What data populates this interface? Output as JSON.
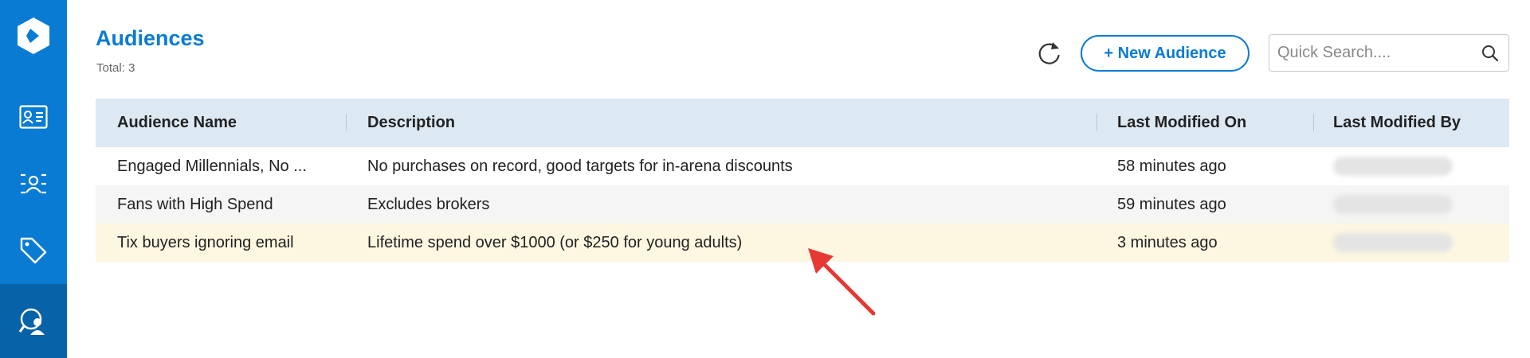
{
  "sidebar": {
    "logo": "app-logo",
    "items": [
      {
        "icon": "contact-card-icon",
        "active": false
      },
      {
        "icon": "people-network-icon",
        "active": false
      },
      {
        "icon": "tag-icon",
        "active": false
      },
      {
        "icon": "audience-search-icon",
        "active": true
      }
    ]
  },
  "header": {
    "title": "Audiences",
    "total": "Total: 3",
    "new_button": "+ New Audience",
    "search_placeholder": "Quick Search...."
  },
  "table": {
    "columns": [
      "Audience Name",
      "Description",
      "Last Modified On",
      "Last Modified By"
    ],
    "rows": [
      {
        "name": "Engaged Millennials, No ...",
        "description": "No purchases on record, good targets for in-arena discounts",
        "modified_on": "58 minutes ago"
      },
      {
        "name": "Fans with High Spend",
        "description": "Excludes brokers",
        "modified_on": "59 minutes ago"
      },
      {
        "name": "Tix buyers ignoring email",
        "description": "Lifetime spend over $1000 (or $250 for young adults)",
        "modified_on": "3 minutes ago"
      }
    ]
  },
  "colors": {
    "accent": "#0a7bd3",
    "sidebar_active": "#0862a8",
    "header_row": "#dde9f2",
    "highlight_row": "#fdf6e1",
    "annotation_arrow": "#e53935"
  }
}
